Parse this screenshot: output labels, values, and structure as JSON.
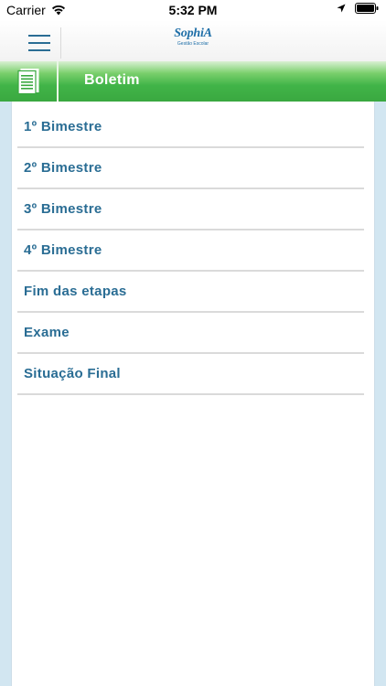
{
  "status_bar": {
    "carrier": "Carrier",
    "time": "5:32 PM"
  },
  "header": {
    "logo_text": "SophiA",
    "logo_subtitle": "Gestão Escolar",
    "menu_icon": "hamburger-menu-icon"
  },
  "page": {
    "title": "Boletim",
    "icon": "document-icon"
  },
  "menu": {
    "items": [
      {
        "label": "1º Bimestre"
      },
      {
        "label": "2º Bimestre"
      },
      {
        "label": "3º Bimestre"
      },
      {
        "label": "4º Bimestre"
      },
      {
        "label": "Fim das etapas"
      },
      {
        "label": "Exame"
      },
      {
        "label": "Situação Final"
      }
    ]
  },
  "colors": {
    "header_green": "#3aa840",
    "item_text": "#2a6d94",
    "side_background": "#d2e6f1",
    "logo_blue": "#1f6fa8"
  }
}
